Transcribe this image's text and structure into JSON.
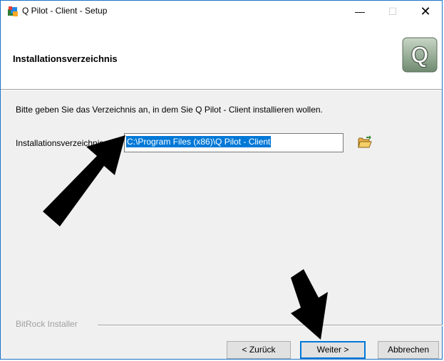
{
  "window": {
    "title": "Q Pilot - Client - Setup",
    "controls": {
      "minimize": "—",
      "maximize": "☐",
      "close": "✕"
    }
  },
  "header": {
    "title": "Installationsverzeichnis",
    "logo_letter": "Q"
  },
  "body": {
    "instruction": "Bitte geben Sie das Verzeichnis an, in dem Sie  Q Pilot - Client installieren wollen.",
    "field_label": "Installationsverzeichnis",
    "field_value": "C:\\Program Files (x86)\\Q Pilot - Client"
  },
  "footer": {
    "branding": "BitRock Installer",
    "back_label": "< Zurück",
    "next_label": "Weiter >",
    "cancel_label": "Abbrechen"
  },
  "colors": {
    "accent": "#0078d7",
    "arrow": "#000000"
  }
}
